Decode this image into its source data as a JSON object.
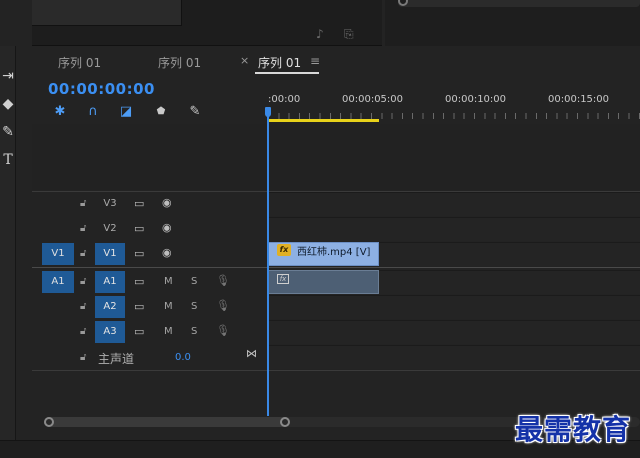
{
  "tabs": [
    {
      "label": "序列 01",
      "active": false
    },
    {
      "label": "序列 01",
      "active": false
    },
    {
      "label": "序列 01",
      "active": true
    }
  ],
  "tab_close": "×",
  "tab_menu": "≡",
  "timecode": "00:00:00:00",
  "ruler": [
    ":00:00",
    "00:00:05:00",
    "00:00:10:00",
    "00:00:15:00"
  ],
  "video_tracks": [
    {
      "src": "V3",
      "target": ""
    },
    {
      "src": "V2",
      "target": ""
    },
    {
      "src": "V1",
      "target": "V1"
    }
  ],
  "audio_tracks": [
    {
      "src": "A1",
      "target": "A1"
    },
    {
      "src": "A2",
      "target": ""
    },
    {
      "src": "A3",
      "target": ""
    }
  ],
  "mute_label": "M",
  "solo_label": "S",
  "master": {
    "label": "主声道",
    "value": "0.0"
  },
  "clip": {
    "name": "西红柿.mp4 [V]",
    "fx": "fx"
  },
  "icons": {
    "lock": "lock-icon",
    "eye": "eye-icon",
    "camera": "camera-icon",
    "mic": "mic-icon",
    "wrench": "wrench-icon",
    "magnet": "magnet-icon",
    "marker": "marker-icon"
  },
  "accent_color": "#3b8ff2",
  "target_color": "#1f5a96",
  "watermark": "最需教育"
}
